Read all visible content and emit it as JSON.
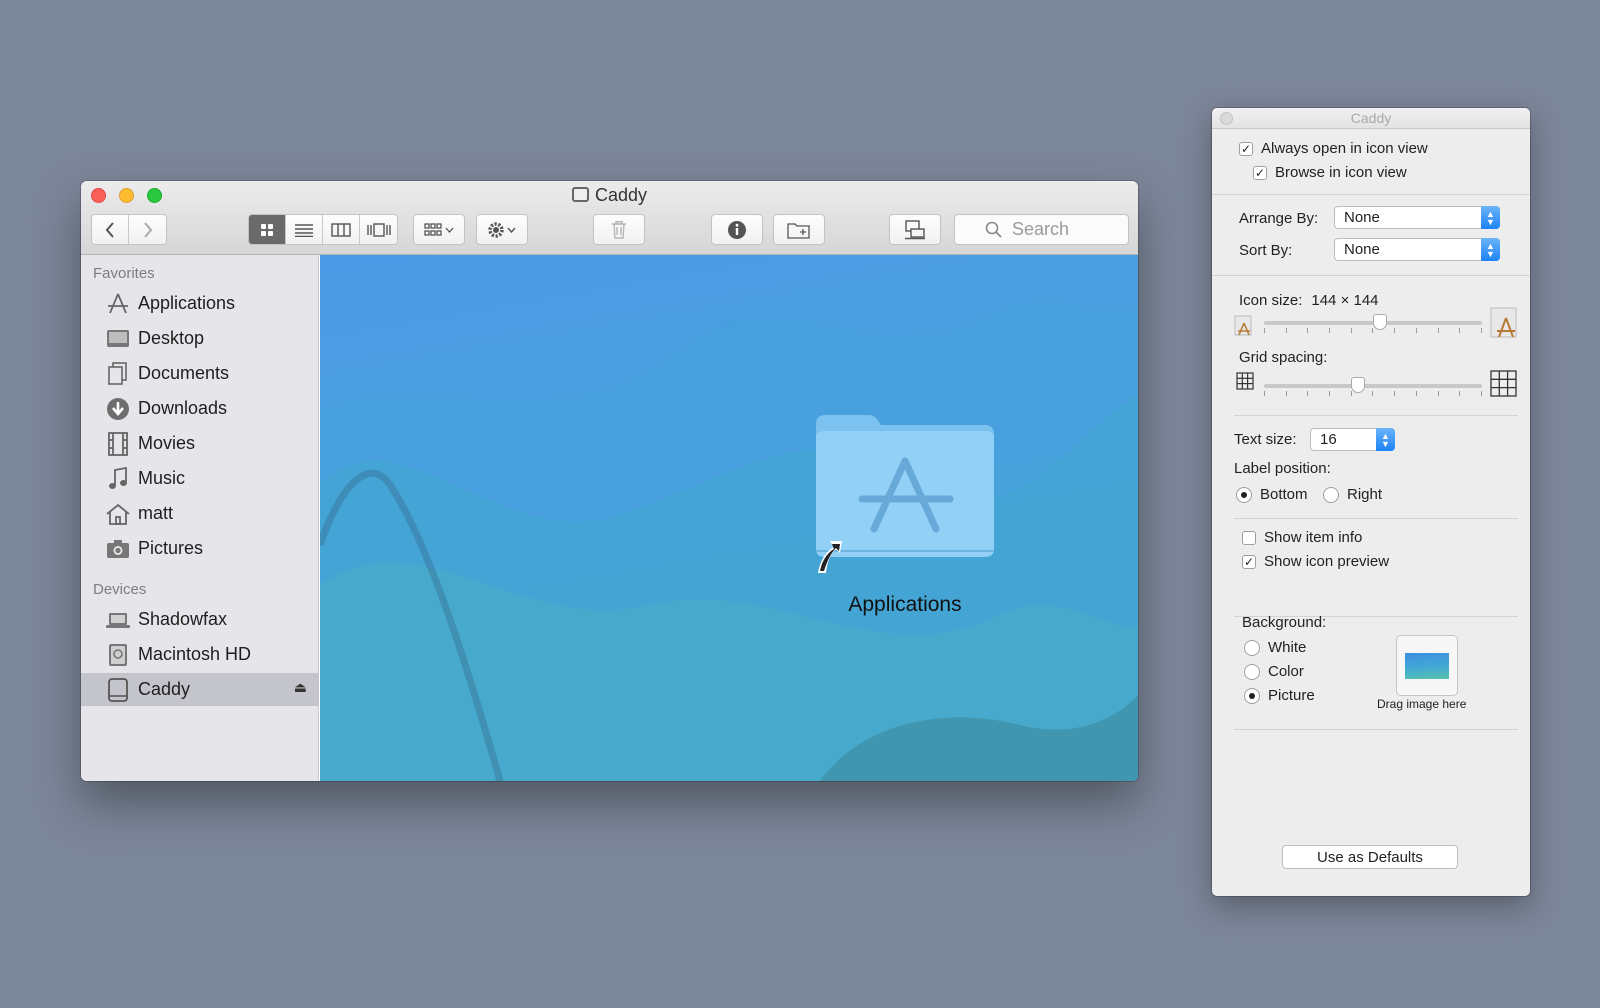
{
  "finder": {
    "title": "Caddy",
    "search_placeholder": "Search",
    "sidebar": {
      "favorites_heading": "Favorites",
      "favorites": [
        {
          "label": "Applications",
          "icon": "applications-icon"
        },
        {
          "label": "Desktop",
          "icon": "desktop-icon"
        },
        {
          "label": "Documents",
          "icon": "documents-icon"
        },
        {
          "label": "Downloads",
          "icon": "downloads-icon"
        },
        {
          "label": "Movies",
          "icon": "movies-icon"
        },
        {
          "label": "Music",
          "icon": "music-icon"
        },
        {
          "label": "matt",
          "icon": "home-icon"
        },
        {
          "label": "Pictures",
          "icon": "pictures-icon"
        }
      ],
      "devices_heading": "Devices",
      "devices": [
        {
          "label": "Shadowfax",
          "icon": "laptop-icon"
        },
        {
          "label": "Macintosh HD",
          "icon": "hard-drive-icon"
        },
        {
          "label": "Caddy",
          "icon": "external-drive-icon",
          "selected": true,
          "eject": "⏏"
        }
      ]
    },
    "content": {
      "items": [
        {
          "label": "Applications",
          "kind": "folder-alias"
        }
      ]
    },
    "colors": {
      "desktop_top": "#4b9ae6",
      "desktop_bottom": "#4bb0c6",
      "sidebar": "#e6e6ea"
    }
  },
  "inspector": {
    "title": "Caddy",
    "always_open_icon_view": "Always open in icon view",
    "browse_icon_view": "Browse in icon view",
    "arrange_by_label": "Arrange By:",
    "arrange_by_value": "None",
    "sort_by_label": "Sort By:",
    "sort_by_value": "None",
    "icon_size_label": "Icon size:",
    "icon_size_value": "144 × 144",
    "icon_size_level": 0.52,
    "grid_spacing_label": "Grid spacing:",
    "grid_spacing_level": 0.43,
    "text_size_label": "Text size:",
    "text_size_value": "16",
    "label_position_label": "Label position:",
    "label_position_options": [
      "Bottom",
      "Right"
    ],
    "label_position_selected": "Bottom",
    "show_item_info": "Show item info",
    "show_icon_preview": "Show icon preview",
    "background_label": "Background:",
    "background_options": [
      "White",
      "Color",
      "Picture"
    ],
    "background_selected": "Picture",
    "drag_image_here": "Drag image here",
    "use_as_defaults": "Use as Defaults"
  }
}
